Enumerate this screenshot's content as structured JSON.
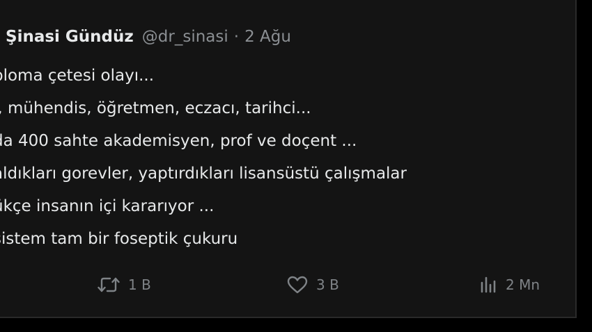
{
  "tweet": {
    "author_name": "Şinasi Gündüz",
    "handle": "@dr_sinasi",
    "separator": "·",
    "date": "2 Ağu",
    "lines": [
      "ploma çetesi olayı...",
      "ı, mühendis, öğretmen, eczacı, tarihci...",
      "da 400 sahte akademisyen, prof ve doçent ...",
      " aldıkları gorevler, yaptırdıkları lisansüstü çalışmalar",
      "ükçe insanın içi kararıyor ...",
      " sistem tam bir foseptik çukuru"
    ]
  },
  "actions": {
    "retweet": {
      "icon": "retweet-icon",
      "count": "1 B"
    },
    "like": {
      "icon": "heart-icon",
      "count": "3 B"
    },
    "views": {
      "icon": "views-icon",
      "count": "2 Mn"
    }
  },
  "colors": {
    "background": "#141414",
    "text": "#e7e9ea",
    "muted": "#8b8f93",
    "action": "#7f8387"
  }
}
